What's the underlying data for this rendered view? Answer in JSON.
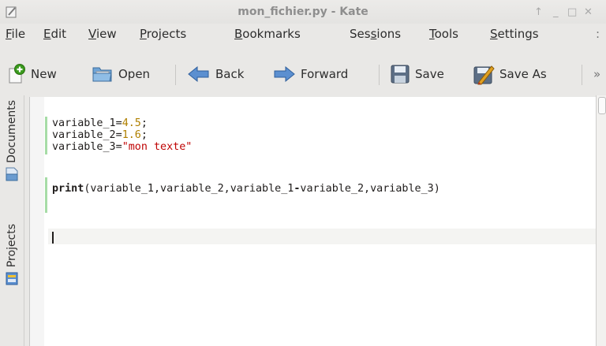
{
  "window": {
    "title": "mon_fichier.py - Kate",
    "controls": [
      "↑",
      "_",
      "□",
      "✕"
    ]
  },
  "menubar": {
    "items": [
      {
        "pre": "",
        "mn": "F",
        "post": "ile"
      },
      {
        "pre": "",
        "mn": "E",
        "post": "dit"
      },
      {
        "pre": "",
        "mn": "V",
        "post": "iew"
      },
      {
        "pre": "",
        "mn": "P",
        "post": "rojects"
      },
      {
        "pre": "",
        "mn": "B",
        "post": "ookmarks"
      },
      {
        "pre": "Ses",
        "mn": "s",
        "post": "ions"
      },
      {
        "pre": "",
        "mn": "T",
        "post": "ools"
      },
      {
        "pre": "",
        "mn": "S",
        "post": "ettings"
      }
    ]
  },
  "toolbar": {
    "new_label": "New",
    "open_label": "Open",
    "back_label": "Back",
    "forward_label": "Forward",
    "save_label": "Save",
    "save_as_label": "Save As",
    "overflow_label": "»"
  },
  "sidebar": {
    "documents_label": "Documents",
    "projects_label": "Projects"
  },
  "editor": {
    "lines": [
      {
        "name": "variable_1",
        "op": "=",
        "value": "4.5",
        "end": ";"
      },
      {
        "name": "variable_2",
        "op": "=",
        "value": "1.6",
        "end": ";"
      },
      {
        "name": "variable_3",
        "op": "=",
        "string": "\"mon texte\""
      }
    ],
    "print_kw": "print",
    "print_args": "(variable_1,variable_2,variable_1",
    "print_minus": "-",
    "print_rest": "variable_2,variable_3)"
  },
  "colors": {
    "number": "#b08000",
    "string": "#bf0303",
    "modified_line_marker": "#a6dca6",
    "current_line": "#f4f4f2"
  },
  "icons": [
    "kate-app-icon",
    "new-document-icon",
    "open-folder-icon",
    "back-arrow-icon",
    "forward-arrow-icon",
    "save-icon",
    "save-as-icon",
    "documents-icon",
    "projects-icon"
  ]
}
